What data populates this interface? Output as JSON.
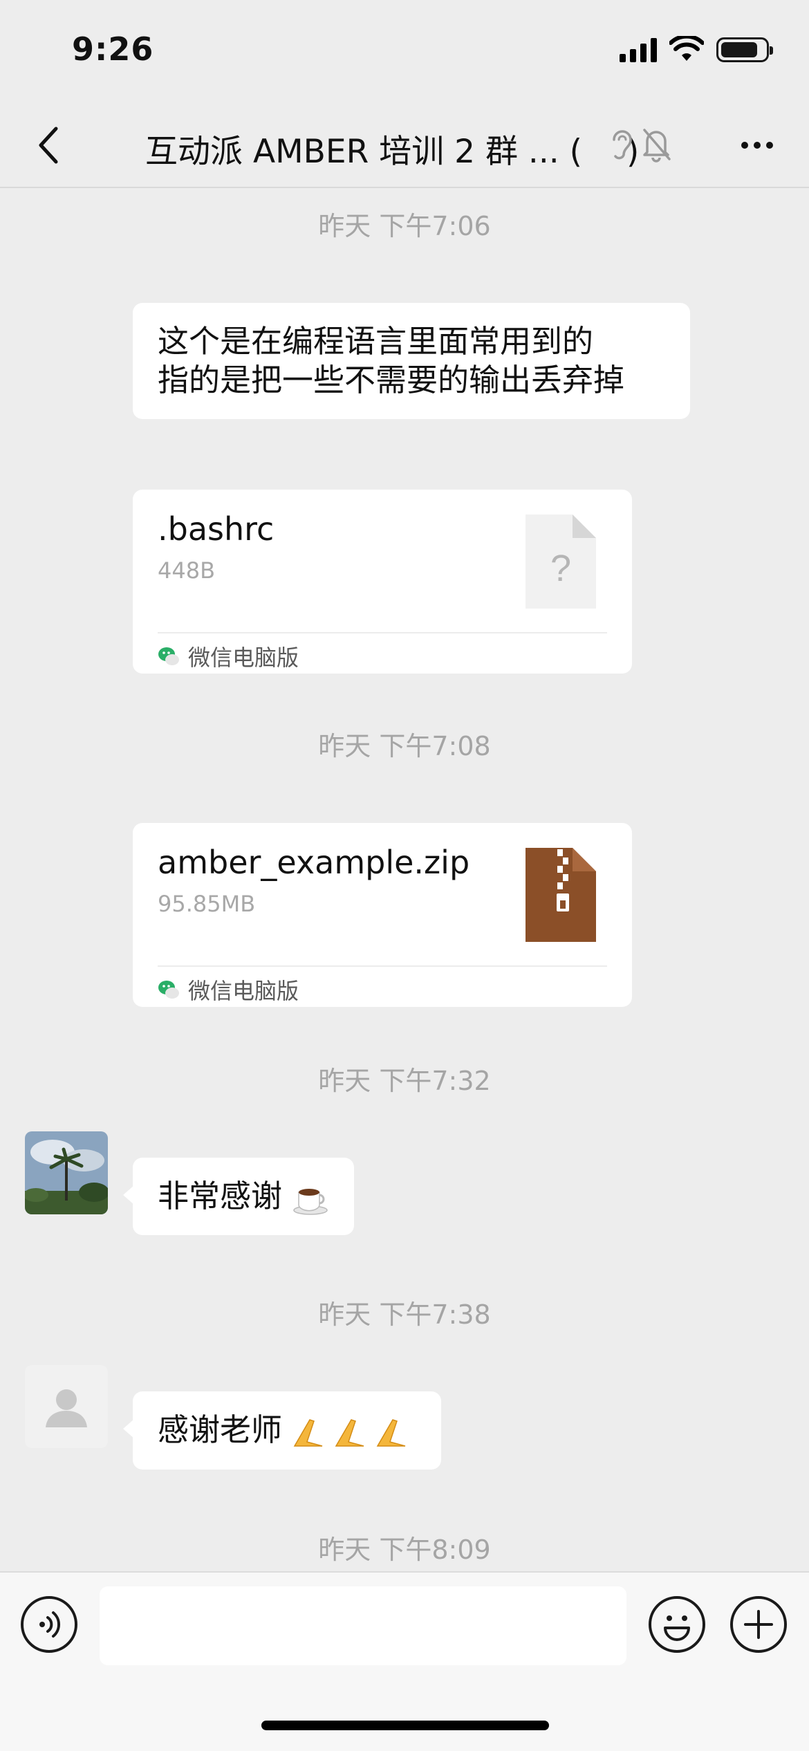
{
  "status_bar": {
    "time": "9:26"
  },
  "nav": {
    "title": "互动派 AMBER 培训 2 群 ... (",
    "title_close": ")"
  },
  "messages": {
    "ts1": "昨天  下午7:06",
    "msg1_line1": "这个是在编程语言里面常用到的",
    "msg1_line2": "指的是把一些不需要的输出丢弃掉",
    "file1": {
      "name": ".bashrc",
      "size": "448B",
      "source": "微信电脑版",
      "icon_glyph": "?"
    },
    "ts2": "昨天  下午7:08",
    "file2": {
      "name": "amber_example.zip",
      "size": "95.85MB",
      "source": "微信电脑版"
    },
    "ts3": "昨天  下午7:32",
    "msg2": "非常感谢",
    "ts4": "昨天  下午7:38",
    "msg3": "感谢老师",
    "ts5": "昨天  下午8:09"
  },
  "input": {
    "placeholder": ""
  },
  "colors": {
    "background": "#ededed",
    "bubble": "#ffffff",
    "timestamp": "#a5a5a5",
    "zip_brown": "#8b4f28"
  },
  "icons": [
    "back-icon",
    "ear-icon",
    "bell-muted-icon",
    "more-icon",
    "question-file-icon",
    "zip-file-icon",
    "wechat-icon",
    "coffee-emoji-icon",
    "pray-emoji-icon",
    "voice-icon",
    "emoji-icon",
    "plus-icon"
  ]
}
